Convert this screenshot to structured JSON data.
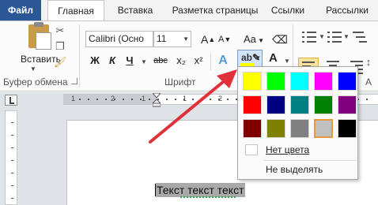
{
  "tabs": [
    {
      "label": "Файл",
      "active": false
    },
    {
      "label": "Главная",
      "active": true
    },
    {
      "label": "Вставка",
      "active": false
    },
    {
      "label": "Разметка страницы",
      "active": false
    },
    {
      "label": "Ссылки",
      "active": false
    },
    {
      "label": "Рассылки",
      "active": false
    }
  ],
  "clipboard": {
    "group_label": "Буфер обмена",
    "paste_label": "Вставить"
  },
  "font": {
    "group_label": "Шрифт",
    "font_name": "Calibri (Осно",
    "font_size": "11",
    "grow_glyph": "A",
    "shrink_glyph": "A",
    "case_glyph": "Aa",
    "bold": "Ж",
    "italic": "К",
    "underline": "Ч",
    "strike": "abc",
    "subscript": "x₂",
    "superscript": "x²",
    "font_color_glyph": "A"
  },
  "paragraph": {
    "group_label": "А"
  },
  "color_menu": {
    "colors": [
      [
        "#ffff00",
        "#00ff00",
        "#00ffff",
        "#ff00ff",
        "#0000ff"
      ],
      [
        "#ff0000",
        "#000080",
        "#008080",
        "#008000",
        "#800080"
      ],
      [
        "#800000",
        "#808000",
        "#808080",
        "#c0c0c0",
        "#000000"
      ]
    ],
    "selected": "#c0c0c0",
    "no_color_label": "Нет цвета",
    "no_highlight_label": "Не выделять"
  },
  "ruler": {
    "numbers": [
      "1",
      "2",
      "1",
      "1",
      "2",
      "3",
      "4",
      "5",
      "6",
      "7",
      "8"
    ]
  },
  "document": {
    "text": "Текст текст текст"
  },
  "colors": {
    "accent_blue": "#2b5797",
    "arrow_red": "#e0313a",
    "highlight_yellow": "#ffff00",
    "font_color_red": "#e03030"
  }
}
